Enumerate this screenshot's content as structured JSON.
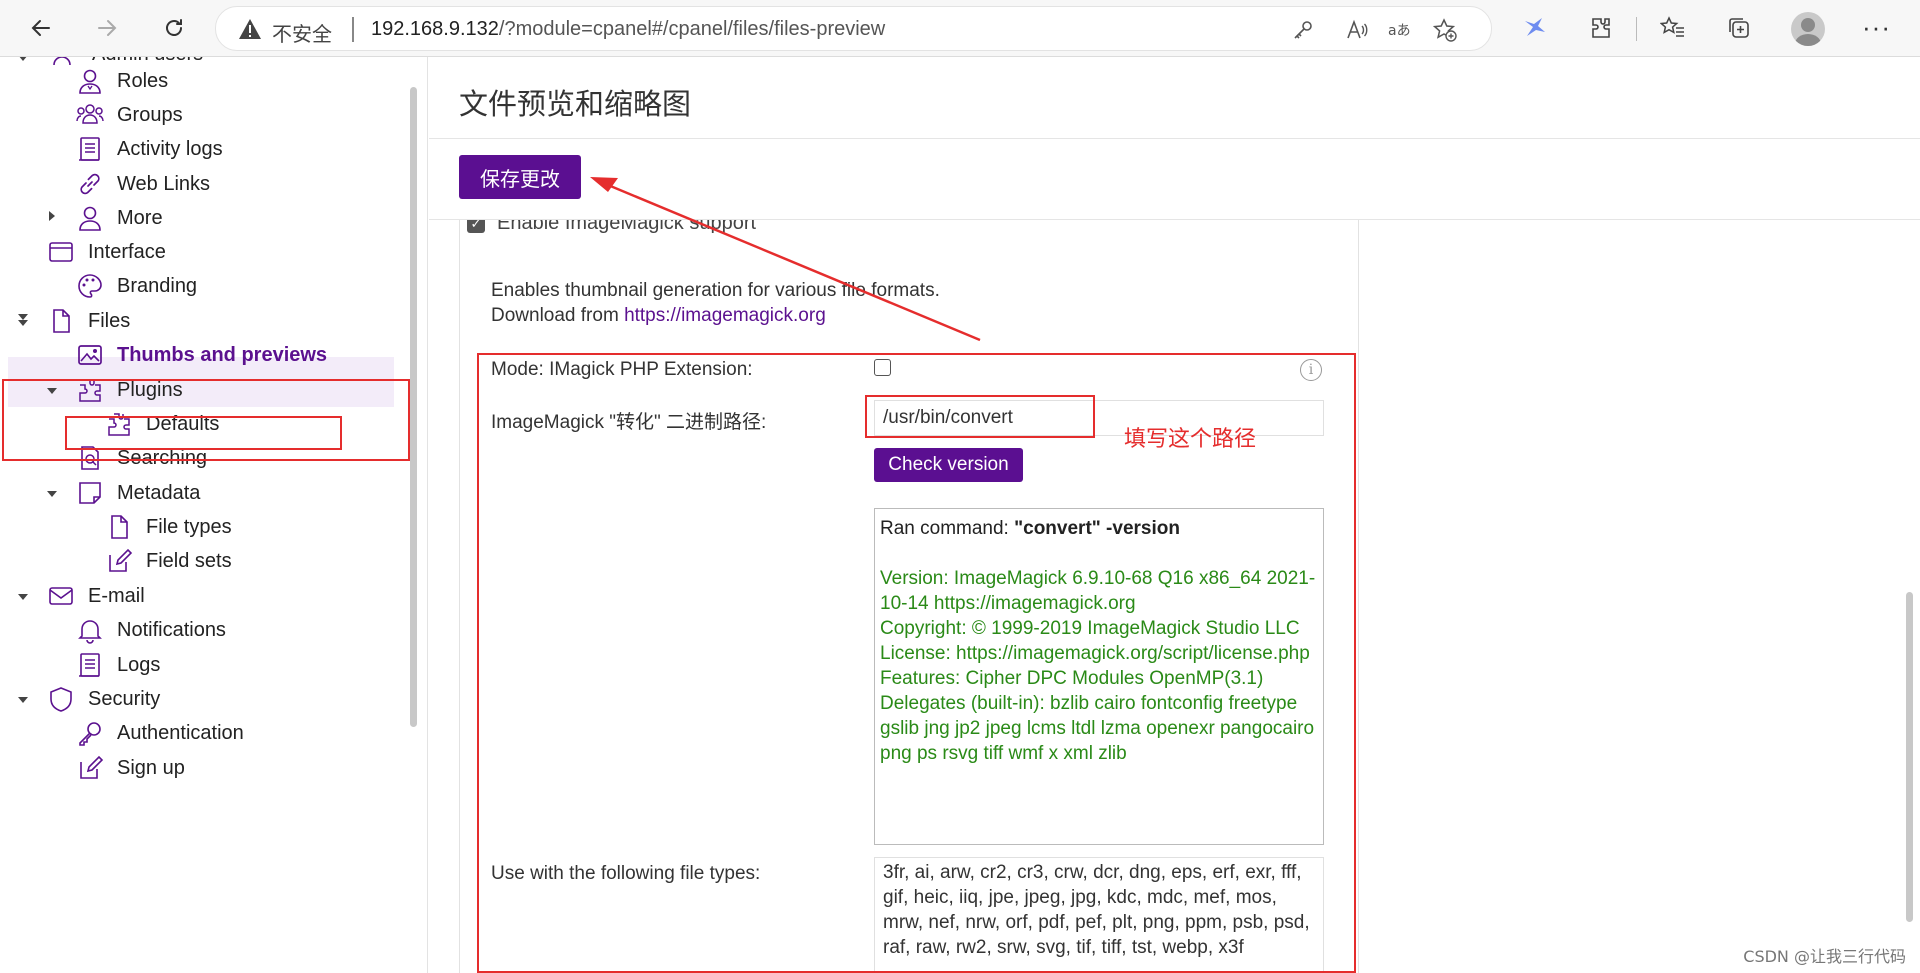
{
  "browser": {
    "insecure_label": "不安全",
    "url_host": "192.168.9.132",
    "url_rest": "/?module=cpanel#/cpanel/files/files-preview"
  },
  "sidebar": {
    "partial_top": "Admin users",
    "items": [
      {
        "label": "Roles",
        "icon": "user-icon"
      },
      {
        "label": "Groups",
        "icon": "users-icon"
      },
      {
        "label": "Activity logs",
        "icon": "log-icon"
      },
      {
        "label": "Web Links",
        "icon": "link-icon"
      },
      {
        "label": "More",
        "icon": "user-icon"
      },
      {
        "label": "Interface",
        "icon": "window-icon"
      },
      {
        "label": "Branding",
        "icon": "palette-icon"
      },
      {
        "label": "Files",
        "icon": "file-icon"
      },
      {
        "label": "Thumbs and previews",
        "icon": "image-icon"
      },
      {
        "label": "Plugins",
        "icon": "puzzle-icon"
      },
      {
        "label": "Defaults",
        "icon": "puzzle-icon"
      },
      {
        "label": "Searching",
        "icon": "search-doc-icon"
      },
      {
        "label": "Metadata",
        "icon": "note-icon"
      },
      {
        "label": "File types",
        "icon": "file-icon"
      },
      {
        "label": "Field sets",
        "icon": "edit-icon"
      },
      {
        "label": "E-mail",
        "icon": "mail-icon"
      },
      {
        "label": "Notifications",
        "icon": "bell-icon"
      },
      {
        "label": "Logs",
        "icon": "log-icon"
      },
      {
        "label": "Security",
        "icon": "shield-icon"
      },
      {
        "label": "Authentication",
        "icon": "key-icon"
      },
      {
        "label": "Sign up",
        "icon": "edit-icon"
      }
    ],
    "active_item": "Thumbs and previews"
  },
  "main": {
    "title": "文件预览和缩略图",
    "save_label": "保存更改",
    "enable_label": "Enable ImageMagick support",
    "desc_line1": "Enables thumbnail generation for various file formats.",
    "desc_line2_prefix": "Download from ",
    "desc_link": "https://imagemagick.org",
    "mode_label": "Mode: IMagick PHP Extension:",
    "mode_checked": false,
    "path_label": "ImageMagick \"转化\" 二进制路径:",
    "path_value": "/usr/bin/convert",
    "check_label": "Check version",
    "output_cmd_prefix": "Ran command: ",
    "output_cmd": "\"convert\" -version",
    "output_version": "Version: ImageMagick 6.9.10-68 Q16 x86_64 2021-10-14 https://imagemagick.org\nCopyright: © 1999-2019 ImageMagick Studio LLC\nLicense: https://imagemagick.org/script/license.php\nFeatures: Cipher DPC Modules OpenMP(3.1)\nDelegates (built-in): bzlib cairo fontconfig freetype gslib jng jp2 jpeg lcms ltdl lzma openexr pangocairo png ps rsvg tiff wmf x xml zlib",
    "types_label": "Use with the following file types:",
    "types_value": "3fr, ai, arw, cr2, cr3, crw, dcr, dng, eps, erf, exr, fff, gif, heic, iiq, jpe, jpeg, jpg, kdc, mdc, mef, mos, mrw, nef, nrw, orf, pdf, pef, plt, png, ppm, psb, psd, raf, raw, rw2, srw, svg, tif, tiff, tst, webp, x3f"
  },
  "annotation": {
    "note": "填写这个路径",
    "color": "#e52d2d"
  },
  "watermark": "CSDN @让我三行代码",
  "colors": {
    "accent": "#5b0f91",
    "version_text": "#2a8a17"
  }
}
